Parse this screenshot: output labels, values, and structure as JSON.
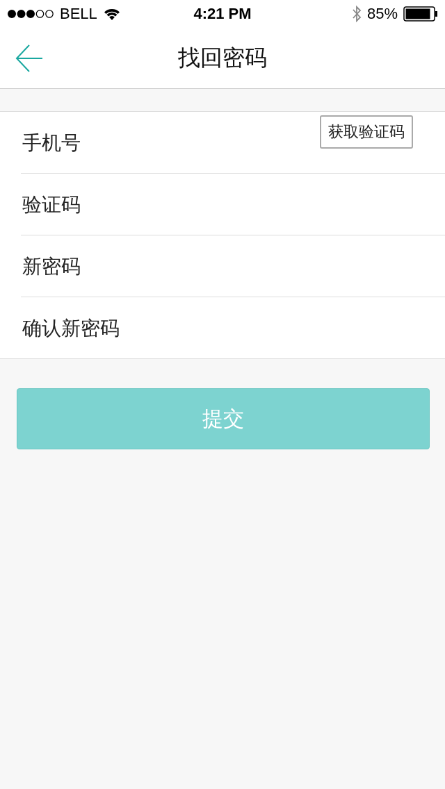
{
  "status_bar": {
    "carrier": "BELL",
    "time": "4:21 PM",
    "battery": "85%"
  },
  "nav": {
    "title": "找回密码"
  },
  "fields": [
    {
      "placeholder": "手机号",
      "action": "获取验证码"
    },
    {
      "placeholder": "验证码"
    },
    {
      "placeholder": "新密码"
    },
    {
      "placeholder": "确认新密码"
    }
  ],
  "submit": {
    "label": "提交"
  }
}
